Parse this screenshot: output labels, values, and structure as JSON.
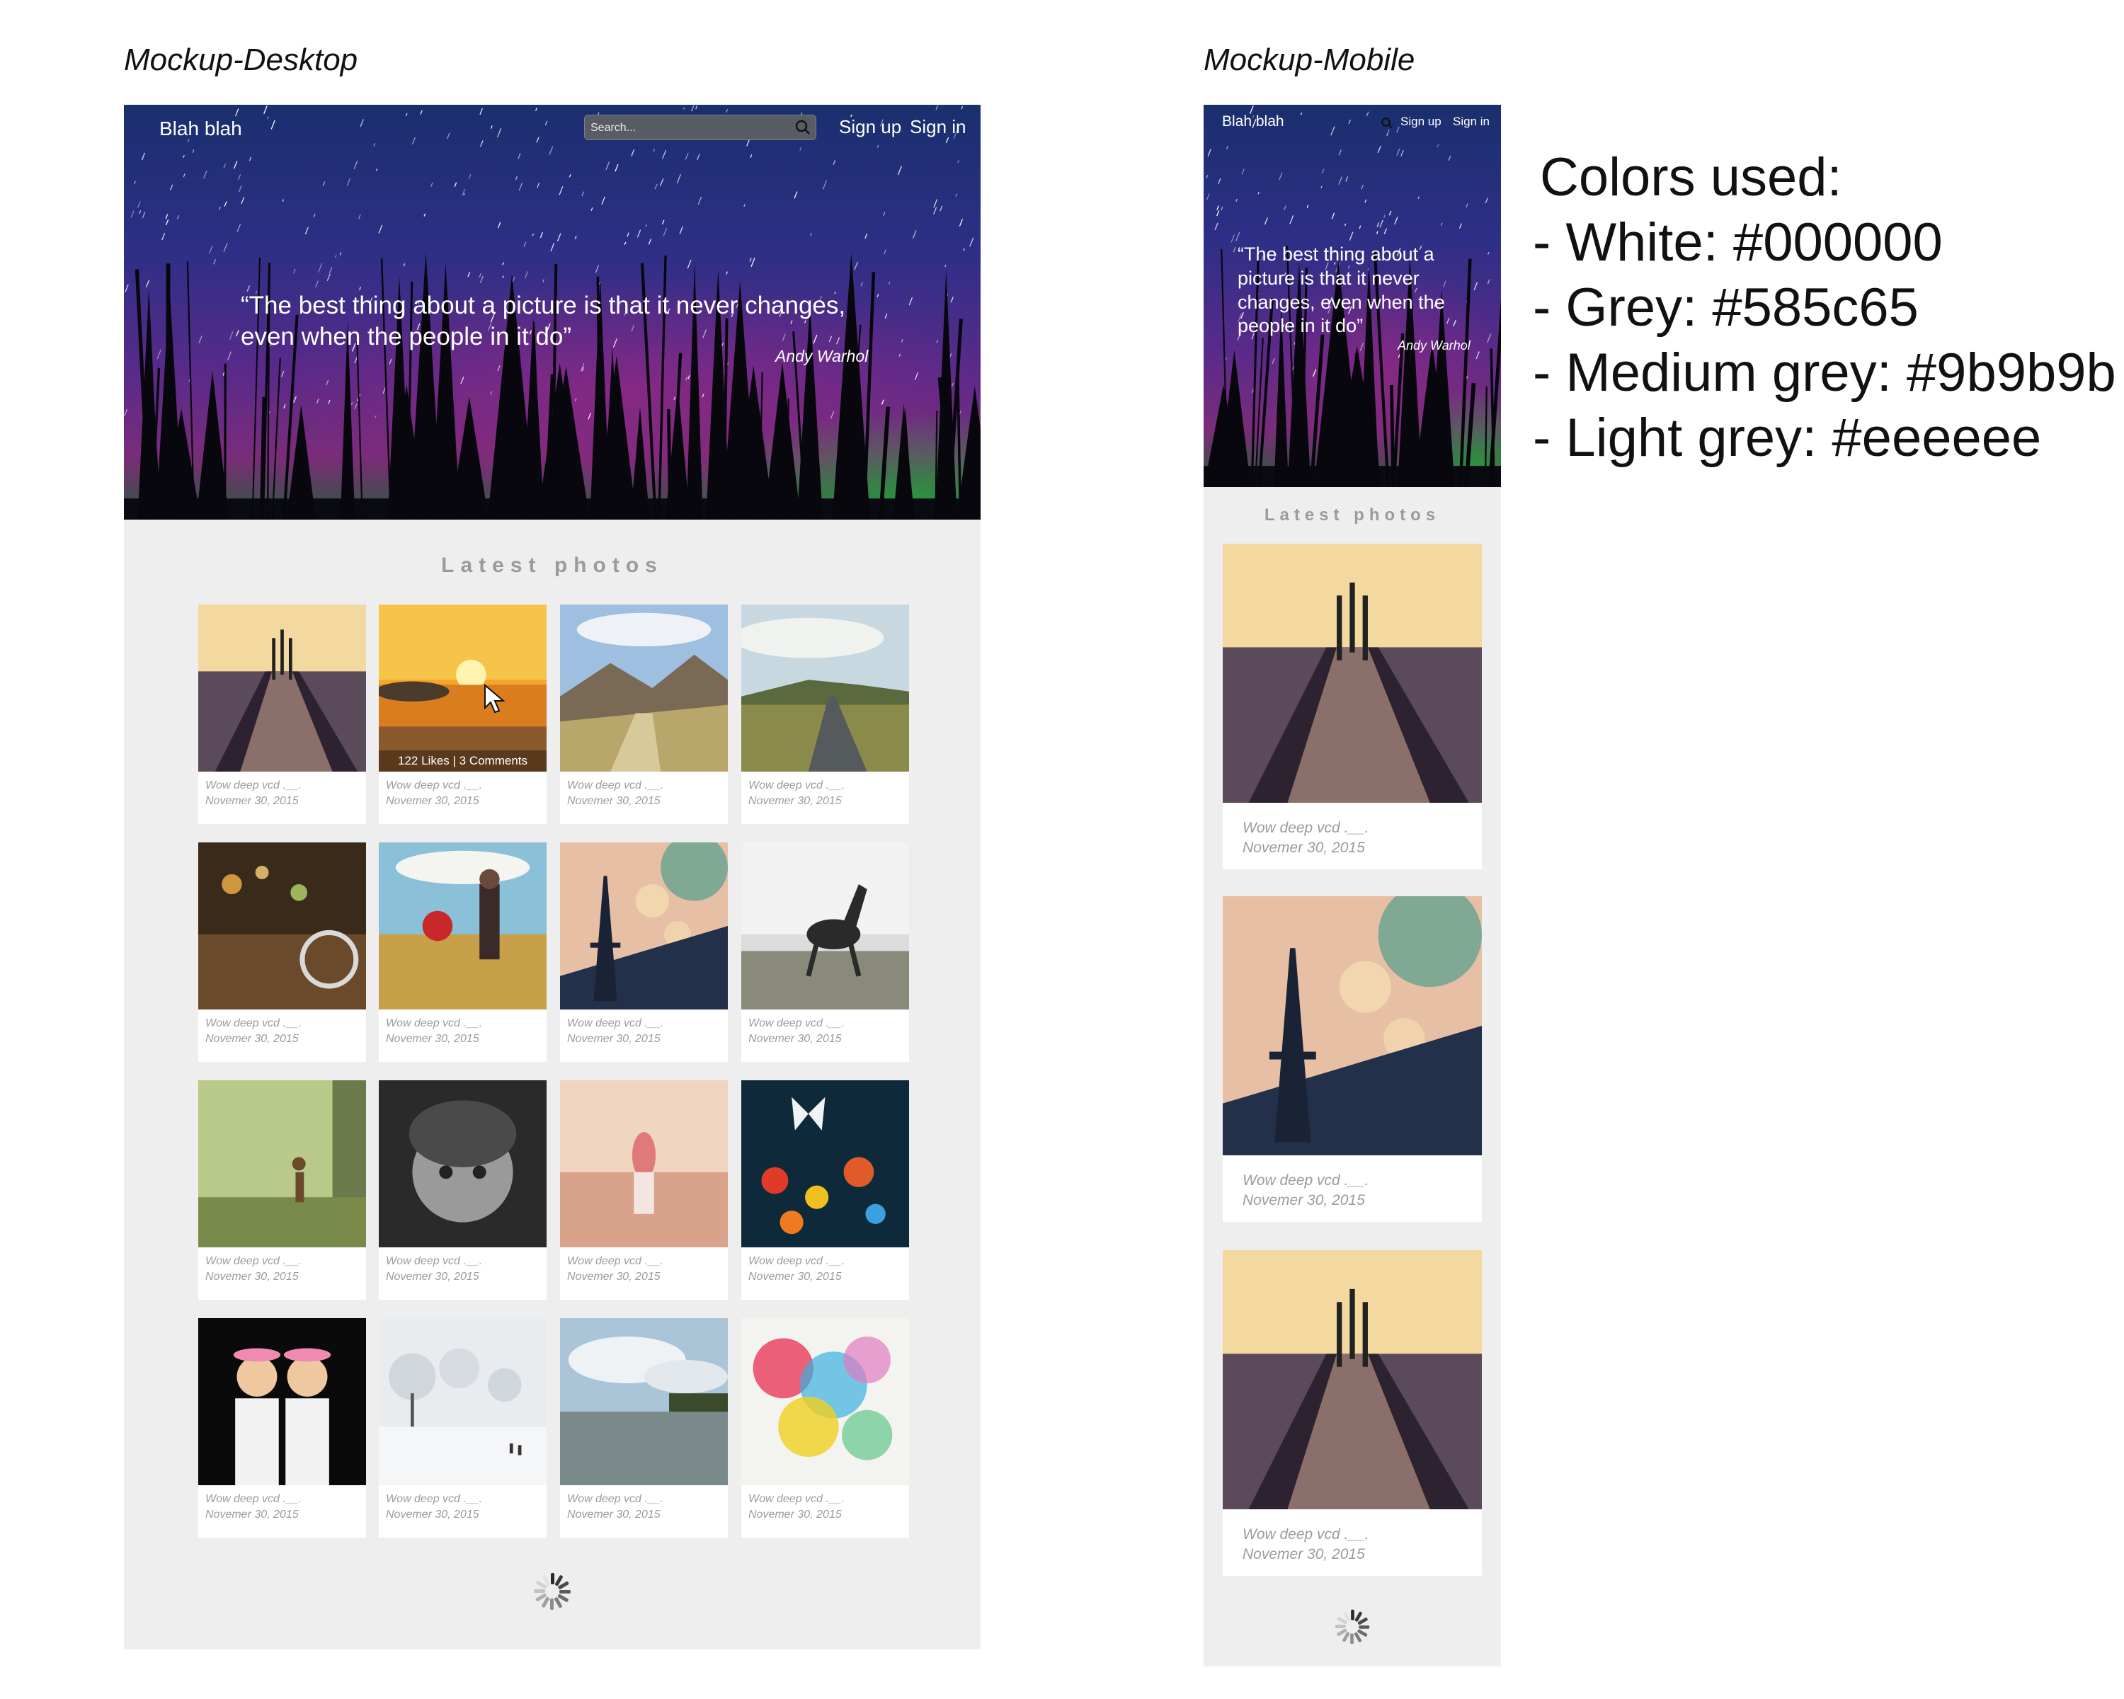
{
  "desktop": {
    "caption": "Mockup-Desktop",
    "brand": "Blah blah",
    "search_placeholder": "Search...",
    "signup": "Sign up",
    "signin": "Sign in",
    "quote": "“The best thing about a picture is that it never changes, even when the people in it do”",
    "author": "Andy Warhol",
    "section_title": "Latest photos",
    "hover_stats": "122 Likes | 3 Comments",
    "photos": [
      {
        "title": "Wow deep vcd .__.",
        "date": "Novemer 30, 2015",
        "subject": "pier-sunset"
      },
      {
        "title": "Wow deep vcd .__.",
        "date": "Novemer 30, 2015",
        "subject": "beach-sunset"
      },
      {
        "title": "Wow deep vcd .__.",
        "date": "Novemer 30, 2015",
        "subject": "mountain-path"
      },
      {
        "title": "Wow deep vcd .__.",
        "date": "Novemer 30, 2015",
        "subject": "open-road"
      },
      {
        "title": "Wow deep vcd .__.",
        "date": "Novemer 30, 2015",
        "subject": "bicycle-night"
      },
      {
        "title": "Wow deep vcd .__.",
        "date": "Novemer 30, 2015",
        "subject": "couple-balloon"
      },
      {
        "title": "Wow deep vcd .__.",
        "date": "Novemer 30, 2015",
        "subject": "eiffel-tower"
      },
      {
        "title": "Wow deep vcd .__.",
        "date": "Novemer 30, 2015",
        "subject": "running-horse"
      },
      {
        "title": "Wow deep vcd .__.",
        "date": "Novemer 30, 2015",
        "subject": "deer-forest"
      },
      {
        "title": "Wow deep vcd .__.",
        "date": "Novemer 30, 2015",
        "subject": "child-portrait"
      },
      {
        "title": "Wow deep vcd .__.",
        "date": "Novemer 30, 2015",
        "subject": "girl-beach"
      },
      {
        "title": "Wow deep vcd .__.",
        "date": "Novemer 30, 2015",
        "subject": "butterfly-flowers"
      },
      {
        "title": "Wow deep vcd .__.",
        "date": "Novemer 30, 2015",
        "subject": "two-girls"
      },
      {
        "title": "Wow deep vcd .__.",
        "date": "Novemer 30, 2015",
        "subject": "snowy-trees"
      },
      {
        "title": "Wow deep vcd .__.",
        "date": "Novemer 30, 2015",
        "subject": "lake-clouds"
      },
      {
        "title": "Wow deep vcd .__.",
        "date": "Novemer 30, 2015",
        "subject": "watercolor"
      }
    ]
  },
  "mobile": {
    "caption": "Mockup-Mobile",
    "brand": "Blah blah",
    "signup": "Sign up",
    "signin": "Sign in",
    "quote": "“The best thing about a picture is that it never changes, even when the people in it do”",
    "author": "Andy Warhol",
    "section_title": "Latest photos",
    "photos": [
      {
        "title": "Wow deep vcd .__.",
        "date": "Novemer 30, 2015",
        "subject": "pier-sunset"
      },
      {
        "title": "Wow deep vcd .__.",
        "date": "Novemer 30, 2015",
        "subject": "eiffel-tower"
      },
      {
        "title": "Wow deep vcd .__.",
        "date": "Novemer 30, 2015",
        "subject": "pier-sunset"
      }
    ]
  },
  "colors_panel": {
    "heading": "Colors used:",
    "items": [
      "- White: #000000",
      "- Grey: #585c65",
      "- Medium grey: #9b9b9b",
      "- Light grey: #eeeeee"
    ]
  },
  "palette": {
    "white": "#ffffff",
    "grey": "#585c65",
    "medium_grey": "#9b9b9b",
    "light_grey": "#eeeeee"
  }
}
